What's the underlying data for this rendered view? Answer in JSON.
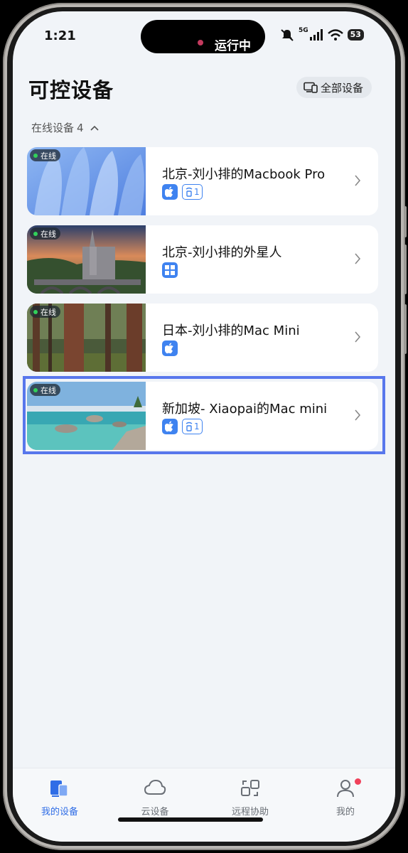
{
  "status_bar": {
    "time": "1:21",
    "live_activity": "运行中",
    "network": "5G",
    "battery": "53"
  },
  "header": {
    "title": "可控设备",
    "all_devices_button": "全部设备"
  },
  "online_section": {
    "label": "在线设备",
    "count": "4"
  },
  "devices": [
    {
      "name": "北京-刘小排的Macbook Pro",
      "status": "在线",
      "os_icon": "apple-icon",
      "shared_count": "1",
      "thumbnail": "blue-abstract-wallpaper"
    },
    {
      "name": "北京-刘小排的外星人",
      "status": "在线",
      "os_icon": "windows-icon",
      "thumbnail": "gothic-church-bridge"
    },
    {
      "name": "日本-刘小排的Mac Mini",
      "status": "在线",
      "os_icon": "apple-icon",
      "thumbnail": "redwood-forest"
    },
    {
      "name": "新加坡- Xiaopai的Mac mini",
      "status": "在线",
      "os_icon": "apple-icon",
      "shared_count": "1",
      "thumbnail": "lake-tahoe-rocks"
    }
  ],
  "tabbar": {
    "tabs": [
      {
        "label": "我的设备",
        "icon": "devices-icon",
        "active": true
      },
      {
        "label": "云设备",
        "icon": "cloud-icon",
        "active": false
      },
      {
        "label": "远程协助",
        "icon": "remote-assist-icon",
        "active": false
      },
      {
        "label": "我的",
        "icon": "profile-icon",
        "active": false
      }
    ]
  },
  "colors": {
    "accent": "#2f6de6",
    "online": "#31d05a",
    "highlight": "#5877ec",
    "notification": "#f0415a"
  }
}
